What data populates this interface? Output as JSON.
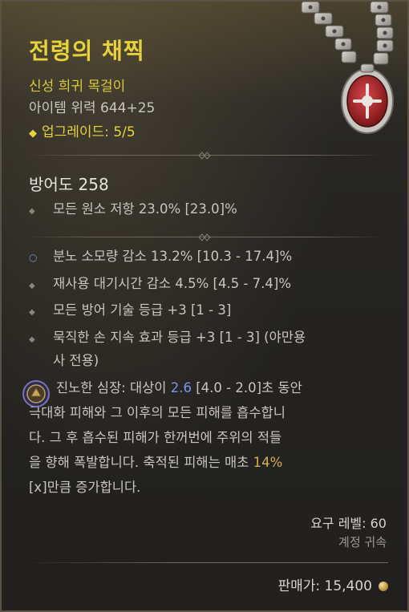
{
  "item": {
    "name": "전령의 채찍",
    "type": "신성 희귀 목걸이",
    "power": "아이템 위력 644+25",
    "upgrade": "업그레이드: 5/5"
  },
  "armor": "방어도 258",
  "implicit": [
    {
      "text": "모든 원소 저항 23.0% [23.0]%"
    }
  ],
  "affixes": [
    {
      "text": "분노 소모량 감소 13.2% [10.3 - 17.4]%",
      "bullet": "blue"
    },
    {
      "text": "재사용 대기시간 감소 4.5% [4.5 - 7.4]%",
      "bullet": "grey"
    },
    {
      "text": "모든 방어 기술 등급 +3 [1 - 3]",
      "bullet": "grey"
    },
    {
      "text": "묵직한 손 지속 효과 등급 +3 [1 - 3] (야만용",
      "text2": "사 전용)",
      "bullet": "grey"
    }
  ],
  "legendary": {
    "line1_a": "진노한 심장: 대상이 ",
    "line1_num": "2.6",
    "line1_b": " [4.0 - 2.0]초 동안",
    "line2": "극대화 피해와 그 이후의 모든 피해를 흡수합니",
    "line3": "다. 그 후 흡수된 피해가 한꺼번에 주위의 적들",
    "line4_a": "을 향해 폭발합니다. 축적된 피해는 매초 ",
    "line4_num": "14%",
    "line5": "[x]만큼 증가합니다."
  },
  "requirements": {
    "level": "요구 레벨: 60",
    "bound": "계정 귀속"
  },
  "price": "판매가: 15,400",
  "colors": {
    "title": "#e6d23a",
    "blue_value": "#7a95e8",
    "gold_value": "#d8b04a"
  },
  "icons": [
    "amulet-icon",
    "legendary-power-icon",
    "gold-coin-icon"
  ]
}
